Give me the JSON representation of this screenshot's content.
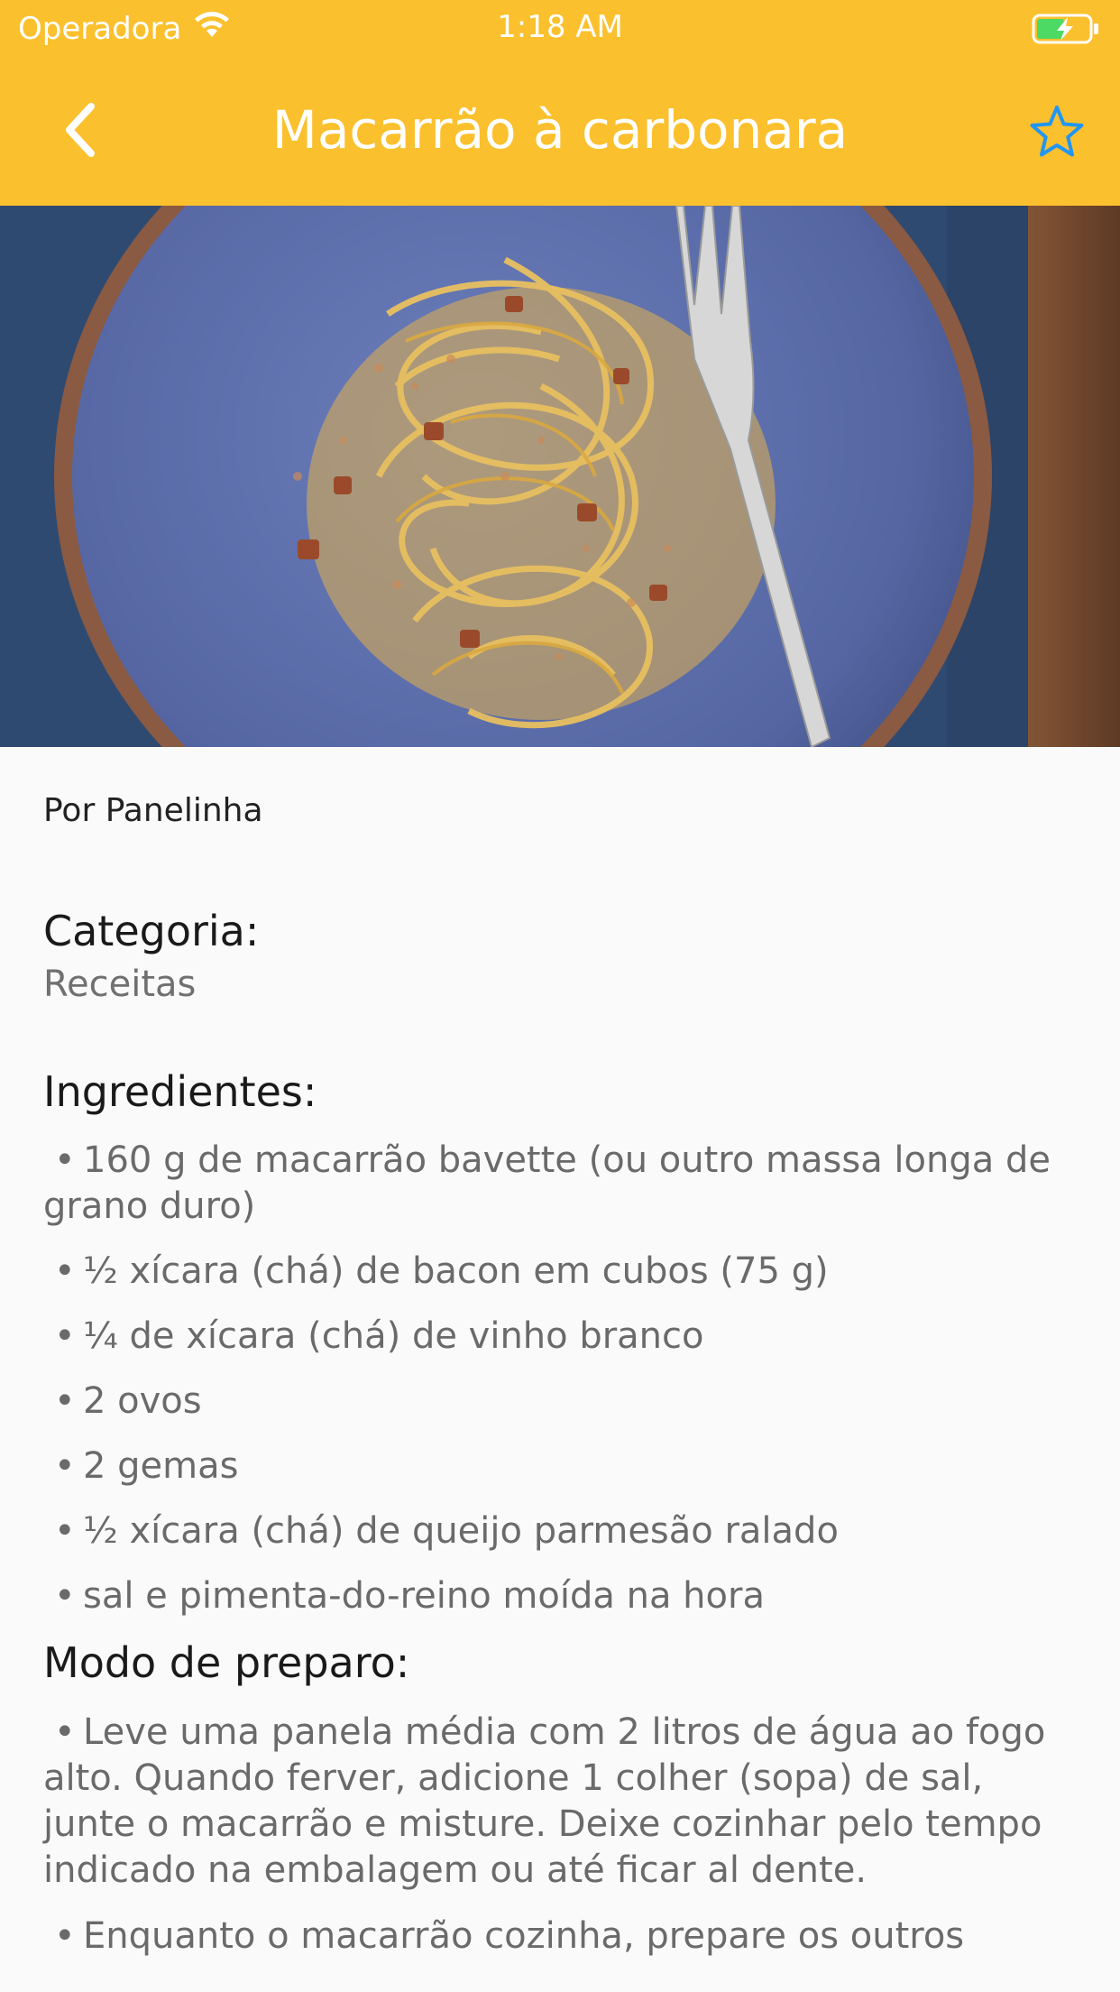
{
  "status_bar": {
    "carrier": "Operadora",
    "time": "1:18 AM",
    "wifi_icon": "wifi-icon",
    "battery_icon": "battery-charging-icon"
  },
  "app_bar": {
    "title": "Macarrão à carbonara",
    "back_icon": "chevron-left-icon",
    "favorite_icon": "star-outline-icon",
    "background_color": "#fbc02d",
    "favorite_color": "#2196f3"
  },
  "hero_image": {
    "subject": "plate of spaghetti carbonara with fork on blue plate"
  },
  "recipe": {
    "author": "Por Panelinha",
    "category_label": "Categoria:",
    "category_value": "Receitas",
    "ingredients_label": "Ingredientes:",
    "ingredients": [
      "160 g de macarrão bavette (ou outro massa longa de grano duro)",
      "½ xícara (chá) de bacon em cubos (75 g)",
      "¼ de xícara (chá) de vinho branco",
      "2 ovos",
      "2 gemas",
      "½ xícara (chá) de queijo parmesão ralado",
      "sal e pimenta-do-reino moída na hora"
    ],
    "preparation_label": "Modo de preparo:",
    "steps": [
      "Leve uma panela média com 2 litros de água ao fogo alto. Quando ferver, adicione 1 colher (sopa) de sal, junte o macarrão e misture. Deixe cozinhar pelo tempo indicado na embalagem ou até ficar al dente.",
      "Enquanto o macarrão cozinha, prepare os outros"
    ],
    "bullet": "•"
  }
}
